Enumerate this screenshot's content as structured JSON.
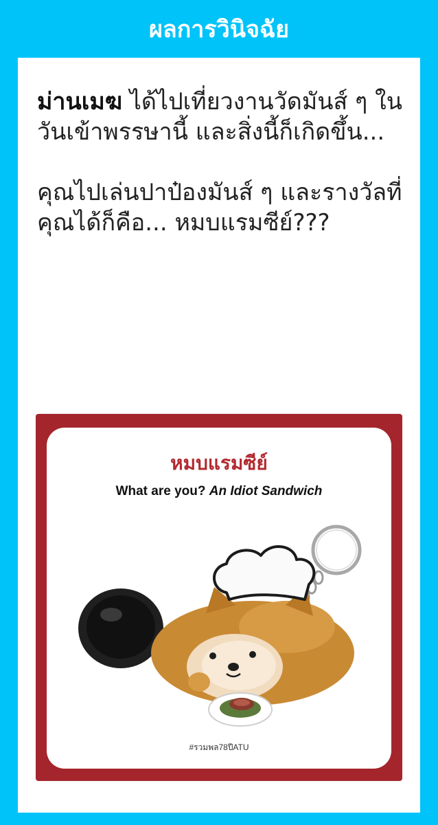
{
  "header": {
    "title": "ผลการวินิจฉัย"
  },
  "message": {
    "name": "ม่านเมฆ",
    "line1_rest": " ได้ไปเที่ยวงานวัดมันส์ ๆ ในวันเข้าพรรษานี้ และสิ่งนี้ก็เกิดขึ้น...",
    "line2": "คุณไปเล่นปาป๋องมันส์ ๆ และรางวัลที่คุณได้ก็คือ... หมบแรมซีย์???"
  },
  "result_card": {
    "title": "หมบแรมซีย์",
    "subtitle_plain": "What are you? ",
    "subtitle_italic": "An Idiot Sandwich",
    "hashtag": "#รวมพล78ปีATU",
    "illustration_icon": "chef-shiba-keychain-with-frying-pan",
    "colors": {
      "frame": "#A5252D",
      "title": "#B22A30",
      "background": "#00C3F9"
    }
  }
}
